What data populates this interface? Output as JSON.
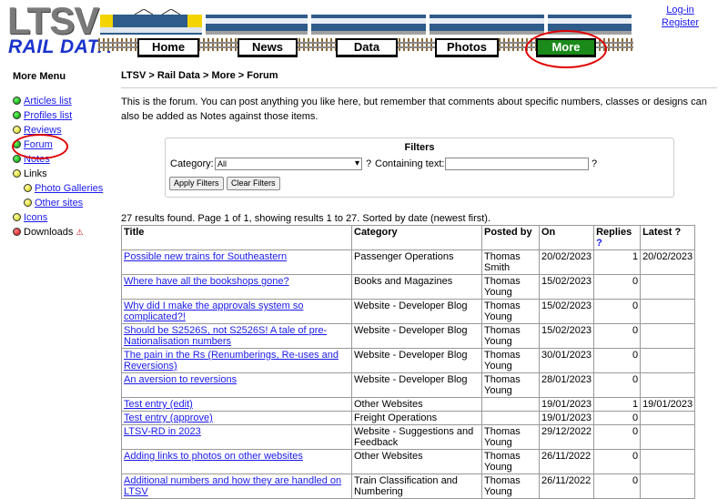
{
  "header": {
    "logo_top": "LTSV",
    "logo_bottom": "RAIL DATA",
    "nav": [
      "Home",
      "News",
      "Data",
      "Photos",
      "More"
    ],
    "login": "Log-in",
    "register": "Register"
  },
  "sidebar": {
    "title": "More Menu",
    "items": [
      {
        "label": "Articles list",
        "color": "green"
      },
      {
        "label": "Profiles list",
        "color": "green"
      },
      {
        "label": "Reviews",
        "color": "yellow"
      },
      {
        "label": "Forum",
        "color": "green"
      },
      {
        "label": "Notes",
        "color": "green"
      },
      {
        "label": "Links",
        "color": "yellow"
      },
      {
        "label": "Photo Galleries",
        "color": "yellow"
      },
      {
        "label": "Other sites",
        "color": "yellow"
      },
      {
        "label": "Icons",
        "color": "yellow"
      },
      {
        "label": "Downloads",
        "color": "red"
      }
    ]
  },
  "breadcrumb": "LTSV > Rail Data > More > Forum",
  "intro": "This is the forum. You can post anything you like here, but remember that comments about specific numbers, classes or designs can also be added as Notes against those items.",
  "filters": {
    "title": "Filters",
    "category_label": "Category:",
    "category_value": "All",
    "help": "?",
    "text_label": "Containing text:",
    "text_value": "",
    "apply": "Apply Filters",
    "clear": "Clear Filters"
  },
  "results_summary": "27 results found. Page 1 of 1, showing results 1 to 27. Sorted by date (newest first).",
  "table": {
    "headers": [
      "Title",
      "Category",
      "Posted by",
      "On",
      "Replies",
      "Latest"
    ],
    "rows": [
      [
        "Possible new trains for Southeastern",
        "Passenger Operations",
        "Thomas Smith",
        "20/02/2023",
        "1",
        "20/02/2023"
      ],
      [
        "Where have all the bookshops gone?",
        "Books and Magazines",
        "Thomas Young",
        "15/02/2023",
        "0",
        ""
      ],
      [
        "Why did I make the approvals system so complicated?!",
        "Website - Developer Blog",
        "Thomas Young",
        "15/02/2023",
        "0",
        ""
      ],
      [
        "Should be S2526S, not S2526S! A tale of pre-Nationalisation numbers",
        "Website - Developer Blog",
        "Thomas Young",
        "15/02/2023",
        "0",
        ""
      ],
      [
        "The pain in the Rs (Renumberings, Re-uses and Reversions)",
        "Website - Developer Blog",
        "Thomas Young",
        "30/01/2023",
        "0",
        ""
      ],
      [
        "An aversion to reversions",
        "Website - Developer Blog",
        "Thomas Young",
        "28/01/2023",
        "0",
        ""
      ],
      [
        "Test entry (edit)",
        "Other Websites",
        "",
        "19/01/2023",
        "1",
        "19/01/2023"
      ],
      [
        "Test entry (approve)",
        "Freight Operations",
        "",
        "19/01/2023",
        "0",
        ""
      ],
      [
        "LTSV-RD in 2023",
        "Website - Suggestions and Feedback",
        "Thomas Young",
        "29/12/2022",
        "0",
        ""
      ],
      [
        "Adding links to photos on other websites",
        "Other Websites",
        "Thomas Young",
        "26/11/2022",
        "0",
        ""
      ],
      [
        "Additional numbers and how they are handled on LTSV",
        "Train Classification and Numbering",
        "Thomas Young",
        "26/11/2022",
        "0",
        ""
      ]
    ]
  }
}
